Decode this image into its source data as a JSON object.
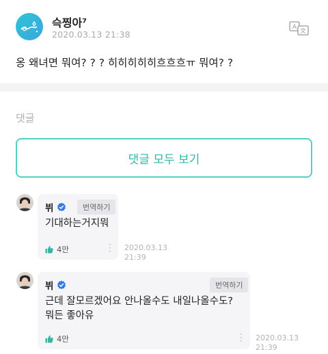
{
  "post": {
    "author": "슥찡아⁷",
    "timestamp": "2020.03.13 21:38",
    "text": "옹 왜녀면 뭐여? ? ? 히히히히히흐흐흐ㅠ 뭐여? ?",
    "translate_icon": "translate-icon"
  },
  "comments_section": {
    "label": "댓글",
    "view_all_label": "댓글 모두 보기"
  },
  "comments": [
    {
      "name": "뷔",
      "translate_label": "번역하기",
      "text_lines": [
        "기대하는거지뭐"
      ],
      "likes": "4만",
      "date": "2020.03.13",
      "time": "21:39"
    },
    {
      "name": "뷔",
      "translate_label": "번역하기",
      "text_lines": [
        "근데 잘모르겠어요 안나올수도 내일나올수도?",
        "뭐든 좋아유"
      ],
      "likes": "4만",
      "date": "2020.03.13",
      "time": "21:39"
    }
  ],
  "colors": {
    "accent": "#2fb7a8",
    "accent_border": "#55cfc3",
    "verified": "#2f7ce8"
  }
}
